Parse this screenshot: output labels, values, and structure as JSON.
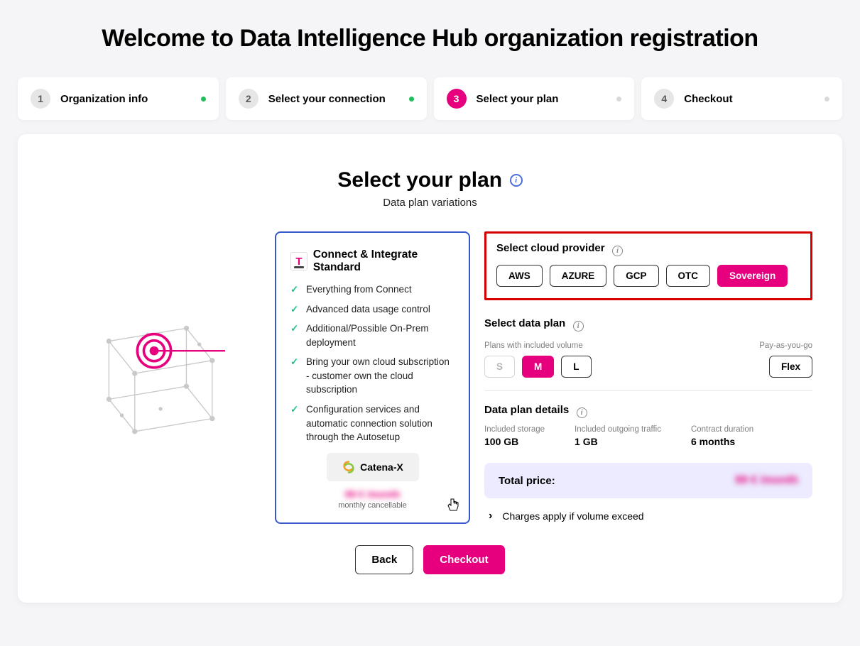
{
  "page_title": "Welcome to Data Intelligence Hub organization registration",
  "stepper": [
    {
      "num": "1",
      "label": "Organization info",
      "state": "done"
    },
    {
      "num": "2",
      "label": "Select your connection",
      "state": "done"
    },
    {
      "num": "3",
      "label": "Select your plan",
      "state": "active"
    },
    {
      "num": "4",
      "label": "Checkout",
      "state": "pending"
    }
  ],
  "section": {
    "title": "Select your plan",
    "subtitle": "Data plan variations"
  },
  "plan_card": {
    "title": "Connect & Integrate Standard",
    "features": [
      "Everything from Connect",
      "Advanced data usage control",
      "Additional/Possible On-Prem deployment",
      "Bring your own cloud subscription - customer own the cloud subscription",
      "Configuration services and automatic connection solution through the Autosetup"
    ],
    "badge": "Catena-X",
    "price_blurred": "99 € /month",
    "cancel_note": "monthly cancellable"
  },
  "cloud_provider": {
    "label": "Select cloud provider",
    "options": [
      "AWS",
      "AZURE",
      "GCP",
      "OTC",
      "Sovereign"
    ],
    "selected": "Sovereign"
  },
  "data_plan": {
    "label": "Select data plan",
    "left_caption": "Plans with included volume",
    "right_caption": "Pay-as-you-go",
    "sizes": [
      "S",
      "M",
      "L"
    ],
    "disabled": [
      "S"
    ],
    "selected": "M",
    "flex_label": "Flex"
  },
  "details": {
    "label": "Data plan details",
    "items": [
      {
        "label": "Included storage",
        "value": "100 GB"
      },
      {
        "label": "Included outgoing traffic",
        "value": "1 GB"
      },
      {
        "label": "Contract duration",
        "value": "6 months"
      }
    ]
  },
  "total": {
    "label": "Total price:",
    "price_blurred": "99 € /month"
  },
  "charges_note": "Charges apply if volume exceed",
  "actions": {
    "back": "Back",
    "checkout": "Checkout"
  }
}
